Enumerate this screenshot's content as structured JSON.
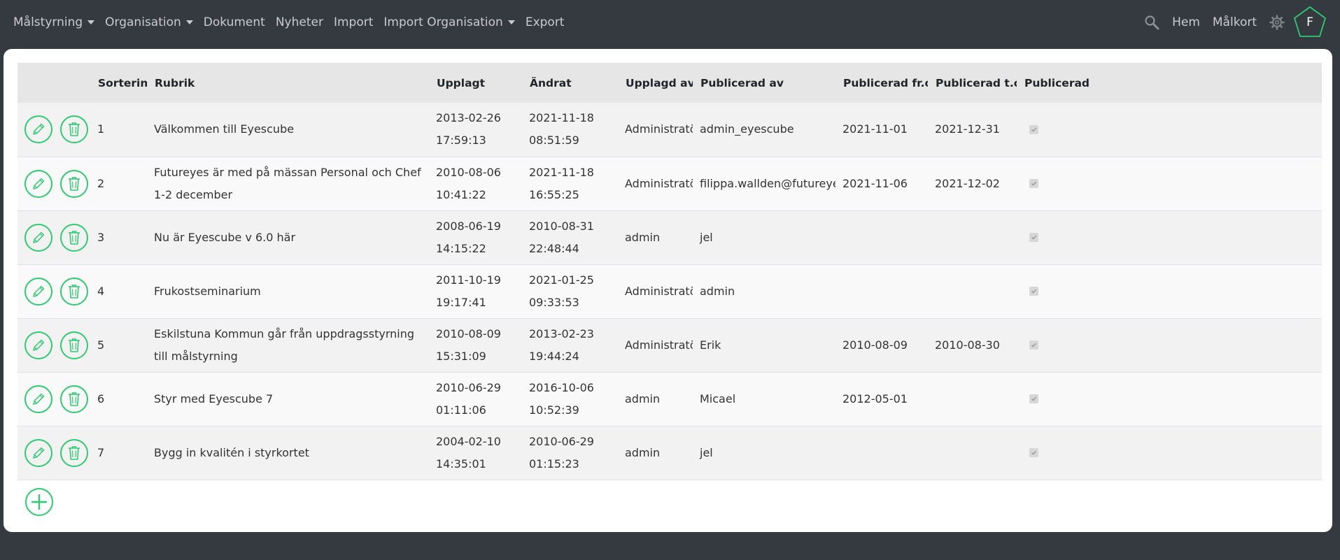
{
  "nav": {
    "left": [
      {
        "label": "Målstyrning",
        "dropdown": true
      },
      {
        "label": "Organisation",
        "dropdown": true
      },
      {
        "label": "Dokument",
        "dropdown": false
      },
      {
        "label": "Nyheter",
        "dropdown": false
      },
      {
        "label": "Import",
        "dropdown": false
      },
      {
        "label": "Import Organisation",
        "dropdown": true
      },
      {
        "label": "Export",
        "dropdown": false
      }
    ],
    "search_icon": "search-icon",
    "home_label": "Hem",
    "scorecard_label": "Målkort",
    "settings_icon": "gear-icon",
    "avatar_letter": "F"
  },
  "colors": {
    "navbar_bg": "#343a40",
    "accent_green": "#2ecc71",
    "header_bg": "#e6e6e6"
  },
  "table": {
    "headers": [
      "",
      "",
      "Sortering",
      "Rubrik",
      "Upplagt",
      "Ändrat",
      "Upplagd av",
      "Publicerad av",
      "Publicerad fr.o.m",
      "Publicerad t.o.m",
      "Publicerad"
    ],
    "rows": [
      {
        "sort": "1",
        "title": "Välkommen till Eyescube",
        "created": "2013-02-26 17:59:13",
        "changed": "2021-11-18 08:51:59",
        "created_by": "Administratör",
        "published_by": "admin_eyescube",
        "from": "2021-11-01",
        "to": "2021-12-31",
        "published": true
      },
      {
        "sort": "2",
        "title": "Futureyes är med på mässan Personal och Chef 1-2 december",
        "created": "2010-08-06 10:41:22",
        "changed": "2021-11-18 16:55:25",
        "created_by": "Administratör",
        "published_by": "filippa.wallden@futureyes.se",
        "from": "2021-11-06",
        "to": "2021-12-02",
        "published": true
      },
      {
        "sort": "3",
        "title": "Nu är Eyescube v 6.0 här",
        "created": "2008-06-19 14:15:22",
        "changed": "2010-08-31 22:48:44",
        "created_by": "admin",
        "published_by": "jel",
        "from": "",
        "to": "",
        "published": true
      },
      {
        "sort": "4",
        "title": "Frukostseminarium",
        "created": "2011-10-19 19:17:41",
        "changed": "2021-01-25 09:33:53",
        "created_by": "Administratör",
        "published_by": "admin",
        "from": "",
        "to": "",
        "published": true
      },
      {
        "sort": "5",
        "title": "Eskilstuna Kommun går från uppdragsstyrning till målstyrning",
        "created": "2010-08-09 15:31:09",
        "changed": "2013-02-23 19:44:24",
        "created_by": "Administratör",
        "published_by": "Erik",
        "from": "2010-08-09",
        "to": "2010-08-30",
        "published": true
      },
      {
        "sort": "6",
        "title": "Styr med Eyescube 7",
        "created": "2010-06-29 01:11:06",
        "changed": "2016-10-06 10:52:39",
        "created_by": "admin",
        "published_by": "Micael",
        "from": "2012-05-01",
        "to": "",
        "published": true
      },
      {
        "sort": "7",
        "title": "Bygg in kvalitén i styrkortet",
        "created": "2004-02-10 14:35:01",
        "changed": "2010-06-29 01:15:23",
        "created_by": "admin",
        "published_by": "jel",
        "from": "",
        "to": "",
        "published": true
      }
    ],
    "row_icons": {
      "edit": "pencil-icon",
      "delete": "trash-icon"
    }
  },
  "add_icon": "plus-icon"
}
